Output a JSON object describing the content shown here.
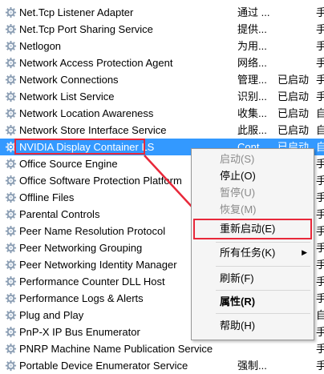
{
  "services": [
    {
      "name": "Net.Tcp Listener Adapter",
      "description": "通过 ...",
      "status": "",
      "startup": "手"
    },
    {
      "name": "Net.Tcp Port Sharing Service",
      "description": "提供...",
      "status": "",
      "startup": "手"
    },
    {
      "name": "Netlogon",
      "description": "为用...",
      "status": "",
      "startup": "手"
    },
    {
      "name": "Network Access Protection Agent",
      "description": "网络...",
      "status": "",
      "startup": "手"
    },
    {
      "name": "Network Connections",
      "description": "管理...",
      "status": "已启动",
      "startup": "手"
    },
    {
      "name": "Network List Service",
      "description": "识别...",
      "status": "已启动",
      "startup": "手"
    },
    {
      "name": "Network Location Awareness",
      "description": "收集...",
      "status": "已启动",
      "startup": "自"
    },
    {
      "name": "Network Store Interface Service",
      "description": "此服...",
      "status": "已启动",
      "startup": "自"
    },
    {
      "name": "NVIDIA Display Container LS",
      "description": "Cont...",
      "status": "已启动",
      "startup": "自"
    },
    {
      "name": "Office  Source Engine",
      "description": "",
      "status": "",
      "startup": "手"
    },
    {
      "name": "Office Software Protection Platform",
      "description": "",
      "status": "",
      "startup": "手"
    },
    {
      "name": "Offline Files",
      "description": "",
      "status": "",
      "startup": "手"
    },
    {
      "name": "Parental Controls",
      "description": "",
      "status": "",
      "startup": "手"
    },
    {
      "name": "Peer Name Resolution Protocol",
      "description": "",
      "status": "",
      "startup": "手"
    },
    {
      "name": "Peer Networking Grouping",
      "description": "",
      "status": "",
      "startup": "手"
    },
    {
      "name": "Peer Networking Identity Manager",
      "description": "",
      "status": "",
      "startup": "手"
    },
    {
      "name": "Performance Counter DLL Host",
      "description": "",
      "status": "",
      "startup": "手"
    },
    {
      "name": "Performance Logs & Alerts",
      "description": "",
      "status": "",
      "startup": "手"
    },
    {
      "name": "Plug and Play",
      "description": "",
      "status": "",
      "startup": "自"
    },
    {
      "name": "PnP-X IP Bus Enumerator",
      "description": "",
      "status": "",
      "startup": "手"
    },
    {
      "name": "PNRP Machine Name Publication Service",
      "description": "",
      "status": "",
      "startup": "手"
    },
    {
      "name": "Portable Device Enumerator Service",
      "description": "强制...",
      "status": "",
      "startup": "手"
    }
  ],
  "selected_index": 8,
  "context_menu": {
    "start": "启动(S)",
    "stop": "停止(O)",
    "pause": "暂停(U)",
    "resume": "恢复(M)",
    "restart": "重新启动(E)",
    "all_tasks": "所有任务(K)",
    "refresh": "刷新(F)",
    "properties": "属性(R)",
    "help": "帮助(H)"
  },
  "colors": {
    "selection": "#3399ff",
    "annotation": "#e8283a",
    "menu_background": "#f5f5f5"
  },
  "icons": {
    "service": "gear-icon",
    "submenu": "chevron-right-icon",
    "annotation_arrow": "arrow-icon"
  }
}
